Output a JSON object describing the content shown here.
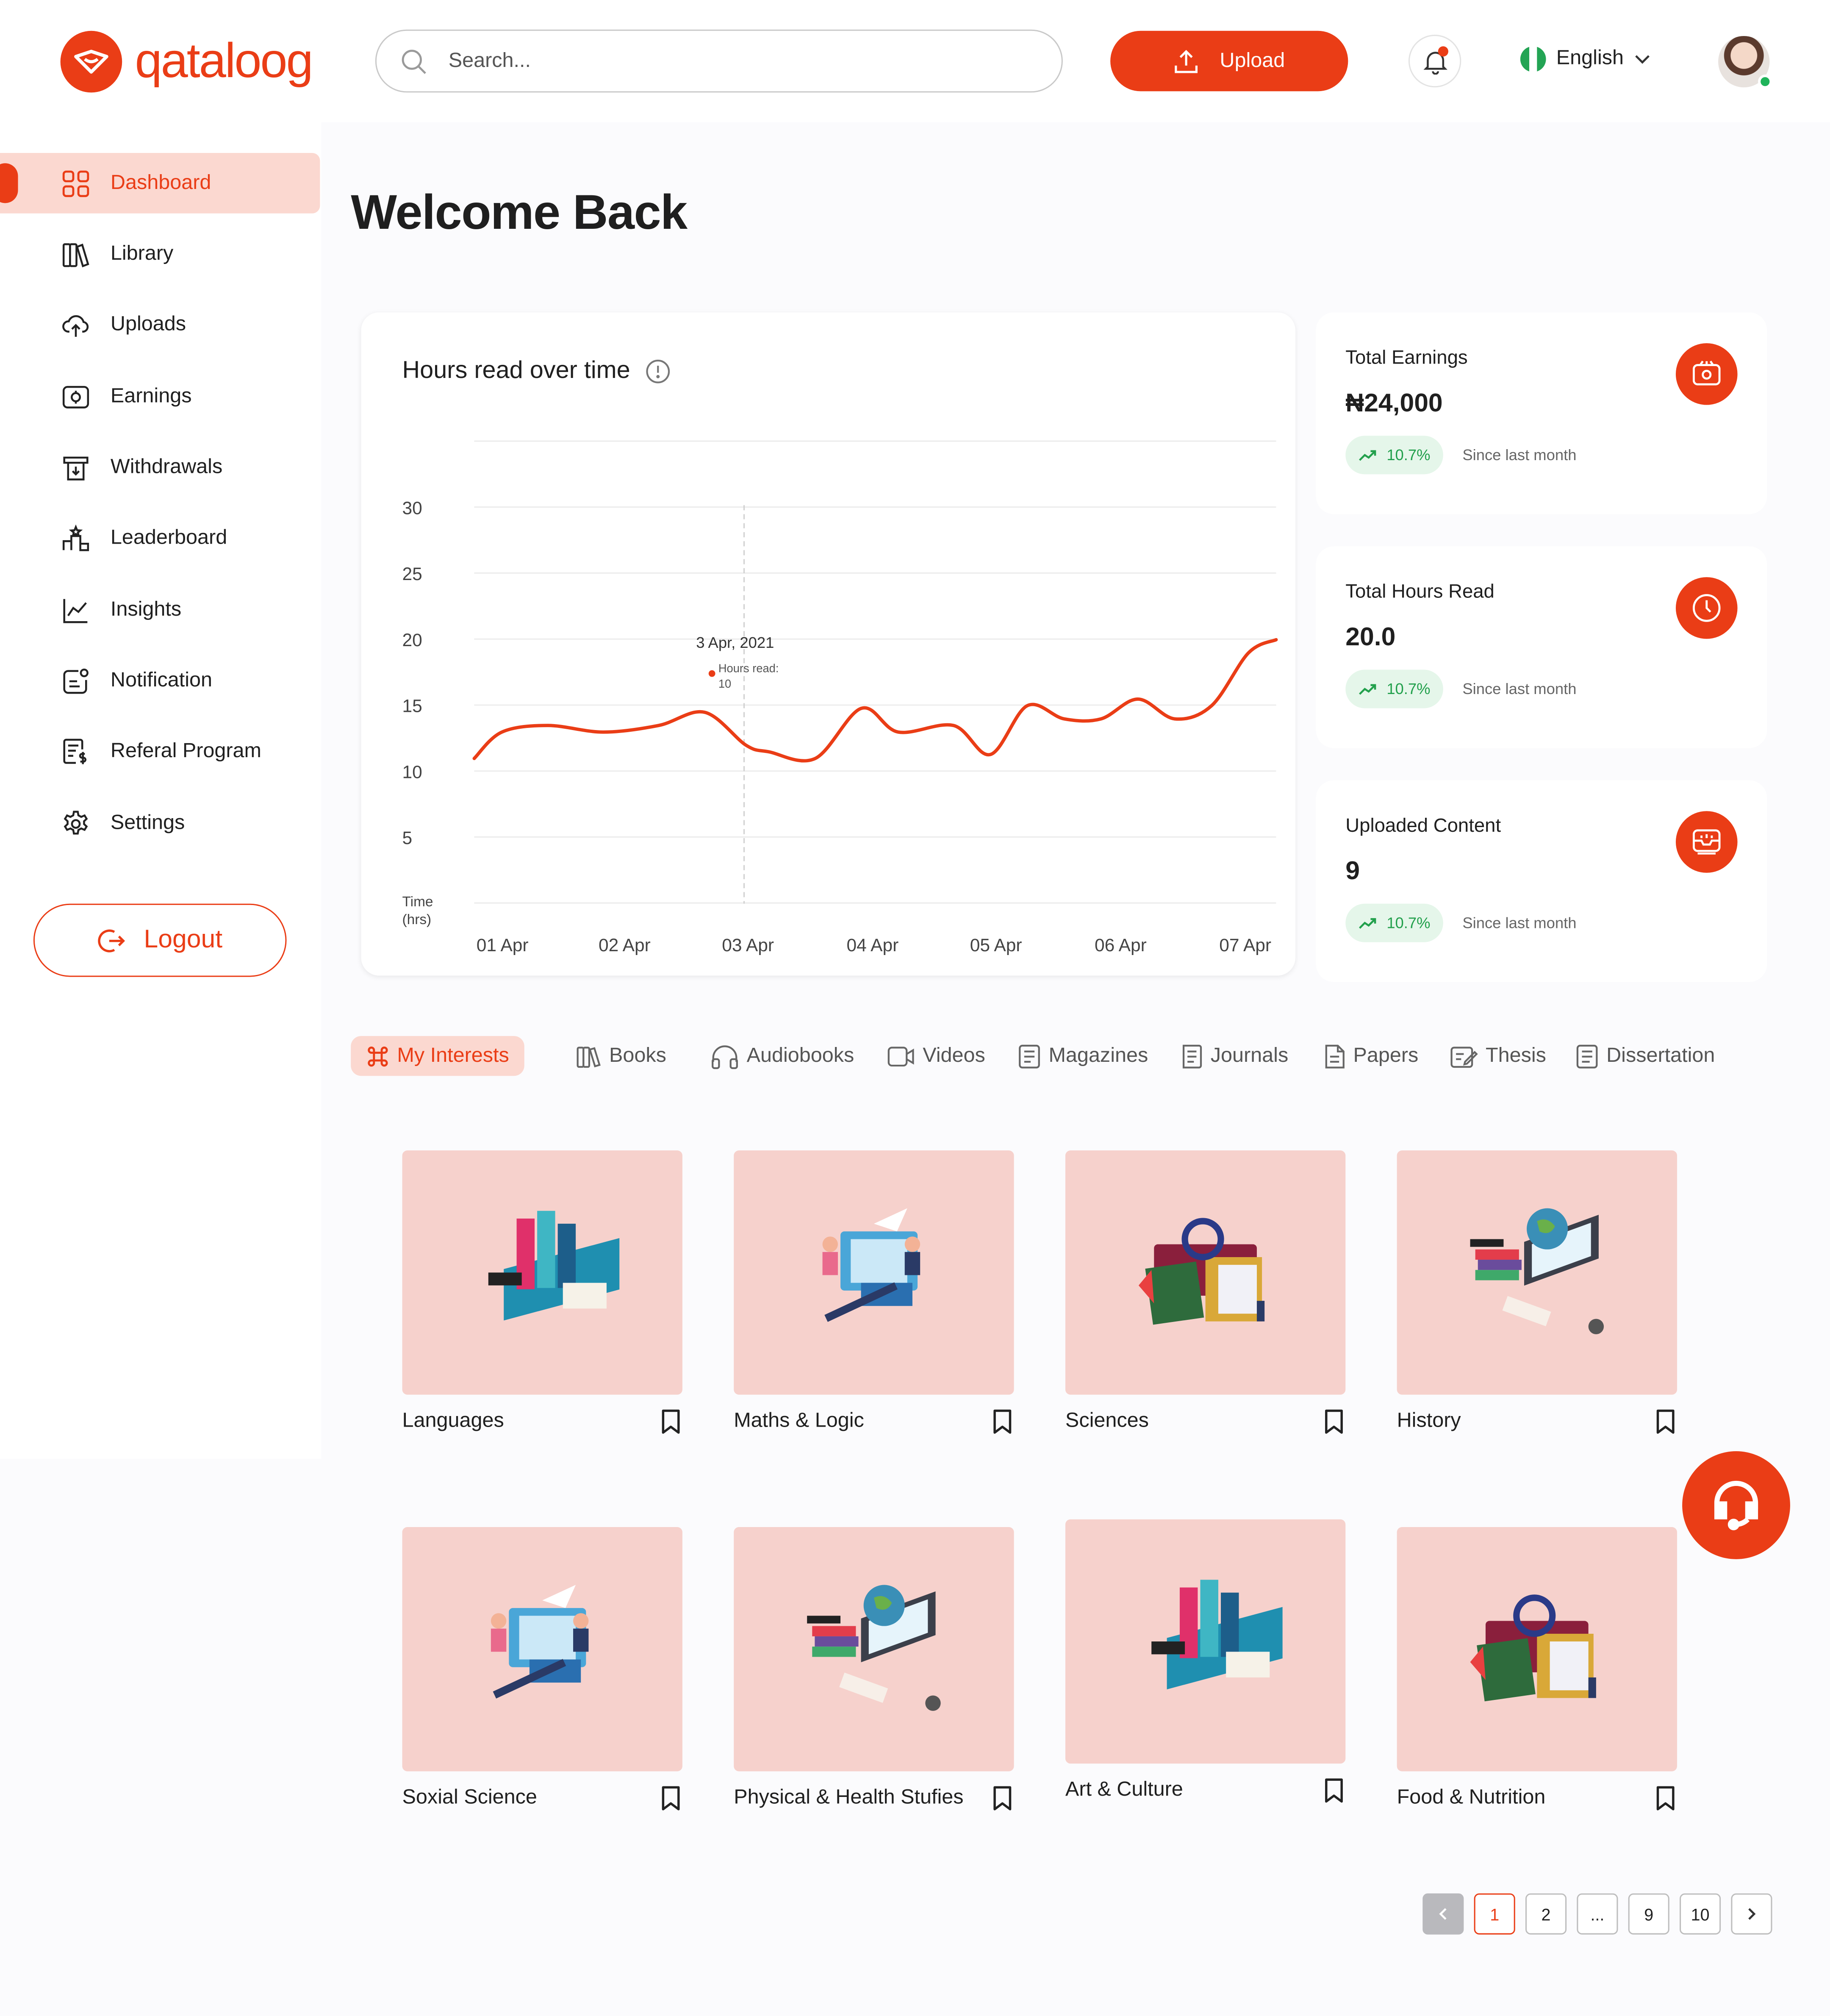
{
  "brand": {
    "name": "qataloog",
    "accent": "#ea3d16"
  },
  "search": {
    "placeholder": "Search..."
  },
  "header": {
    "upload_label": "Upload",
    "language": "English"
  },
  "sidebar": {
    "items": [
      {
        "label": "Dashboard",
        "icon": "grid-icon"
      },
      {
        "label": "Library",
        "icon": "books-icon"
      },
      {
        "label": "Uploads",
        "icon": "cloud-upload-icon"
      },
      {
        "label": "Earnings",
        "icon": "wallet-icon"
      },
      {
        "label": "Withdrawals",
        "icon": "withdraw-icon"
      },
      {
        "label": "Leaderboard",
        "icon": "podium-icon"
      },
      {
        "label": "Insights",
        "icon": "line-chart-icon"
      },
      {
        "label": "Notification",
        "icon": "notification-icon"
      },
      {
        "label": "Referal Program",
        "icon": "referral-icon"
      },
      {
        "label": "Settings",
        "icon": "gear-icon"
      }
    ],
    "logout_label": "Logout"
  },
  "main": {
    "welcome": "Welcome Back"
  },
  "chart_data": {
    "type": "line",
    "title": "Hours read over time",
    "xlabel": "",
    "ylabel": "Time\n(hrs)",
    "ylabel_lines": [
      "Time",
      "(hrs)"
    ],
    "ylim": [
      0,
      30
    ],
    "y_ticks": [
      "5",
      "10",
      "15",
      "20",
      "25",
      "30"
    ],
    "categories": [
      "01 Apr",
      "02 Apr",
      "03 Apr",
      "04 Apr",
      "05 Apr",
      "06 Apr",
      "07 Apr"
    ],
    "x": [
      0,
      0.3,
      0.8,
      1.4,
      2.0,
      2.5,
      2.95,
      3.2,
      3.7,
      4.2,
      4.6,
      5.2,
      5.6,
      6.0,
      6.4,
      6.8,
      7.2,
      7.6,
      8.0,
      8.4,
      8.7
    ],
    "y": [
      11,
      13,
      13.5,
      13,
      13.5,
      14.5,
      12,
      11.5,
      11,
      14.8,
      13,
      13.5,
      11.3,
      15,
      14,
      14,
      15.5,
      14,
      15,
      19,
      20
    ],
    "series": [
      {
        "values": [
          11,
          13.5,
          11,
          13.5,
          11.3,
          14,
          19
        ]
      }
    ],
    "tooltip": {
      "date": "3 Apr, 2021",
      "label": "Hours read:",
      "value": "10"
    },
    "grid": true,
    "line_color": "#ea3d16"
  },
  "stats": [
    {
      "label": "Total Earnings",
      "value": "₦24,000",
      "change": "10.7%",
      "since": "Since last month",
      "icon": "wallet-icon"
    },
    {
      "label": "Total Hours Read",
      "value": "20.0",
      "change": "10.7%",
      "since": "Since last month",
      "icon": "clock-icon"
    },
    {
      "label": "Uploaded Content",
      "value": "9",
      "change": "10.7%",
      "since": "Since last month",
      "icon": "inbox-icon"
    }
  ],
  "tabs": [
    {
      "label": "My Interests",
      "icon": "command-icon"
    },
    {
      "label": "Books",
      "icon": "books-icon"
    },
    {
      "label": "Audiobooks",
      "icon": "headphones-icon"
    },
    {
      "label": "Videos",
      "icon": "video-icon"
    },
    {
      "label": "Magazines",
      "icon": "magazine-icon"
    },
    {
      "label": "Journals",
      "icon": "journal-icon"
    },
    {
      "label": "Papers",
      "icon": "paper-icon"
    },
    {
      "label": "Thesis",
      "icon": "thesis-icon"
    },
    {
      "label": "Dissertation",
      "icon": "dissertation-icon"
    }
  ],
  "interests": [
    {
      "name": "Languages",
      "art": "books-stack"
    },
    {
      "name": "Maths & Logic",
      "art": "graduates"
    },
    {
      "name": "Sciences",
      "art": "big-books"
    },
    {
      "name": "History",
      "art": "globe-laptop"
    },
    {
      "name": "Soxial Science",
      "art": "graduates"
    },
    {
      "name": "Physical & Health Stufies",
      "art": "globe-laptop"
    },
    {
      "name": "Art & Culture",
      "art": "books-stack"
    },
    {
      "name": "Food & Nutrition",
      "art": "big-books"
    }
  ],
  "pagination": {
    "pages": [
      "1",
      "2",
      "...",
      "9",
      "10"
    ],
    "current": "1"
  }
}
